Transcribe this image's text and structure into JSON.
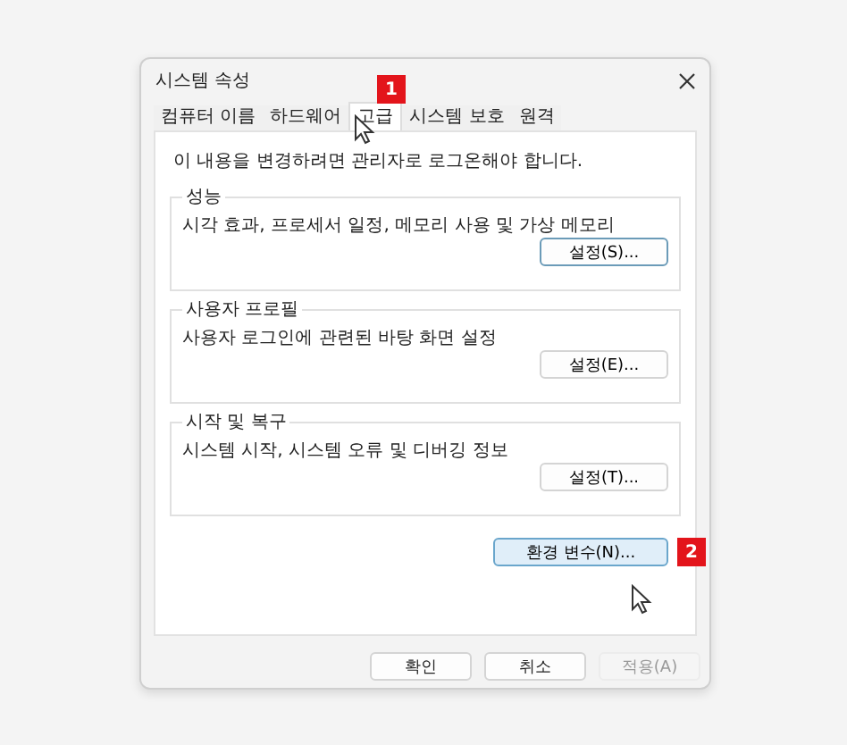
{
  "window": {
    "title": "시스템 속성"
  },
  "tabs": [
    {
      "label": "컴퓨터 이름",
      "selected": false
    },
    {
      "label": "하드웨어",
      "selected": false
    },
    {
      "label": "고급",
      "selected": true
    },
    {
      "label": "시스템 보호",
      "selected": false
    },
    {
      "label": "원격",
      "selected": false
    }
  ],
  "notice": "이 내용을 변경하려면 관리자로 로그온해야 합니다.",
  "groups": [
    {
      "title": "성능",
      "description": "시각 효과, 프로세서 일정, 메모리 사용 및 가상 메모리",
      "button": "설정(S)...",
      "focused": true
    },
    {
      "title": "사용자 프로필",
      "description": "사용자 로그인에 관련된 바탕 화면 설정",
      "button": "설정(E)...",
      "focused": false
    },
    {
      "title": "시작 및 복구",
      "description": "시스템 시작, 시스템 오류 및 디버깅 정보",
      "button": "설정(T)...",
      "focused": false
    }
  ],
  "env_button": {
    "label": "환경 변수(N)...",
    "hovered": true
  },
  "step_badges": [
    "1",
    "2"
  ],
  "buttons": [
    {
      "label": "확인",
      "disabled": false
    },
    {
      "label": "취소",
      "disabled": false
    },
    {
      "label": "적용(A)",
      "disabled": true
    }
  ]
}
